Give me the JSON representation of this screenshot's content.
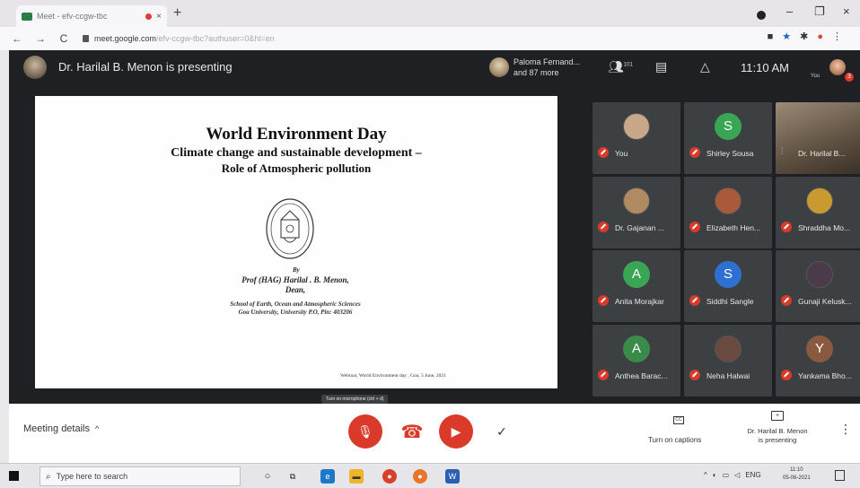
{
  "browser": {
    "tab_title": "Meet - efv-ccgw-tbc",
    "tab_close": "×",
    "new_tab": "+",
    "url_host": "meet.google.com",
    "url_path": "/efv-ccgw-tbc?authuser=0&hl=en",
    "nav_back": "←",
    "nav_forward": "→",
    "nav_reload": "C",
    "window_minimize": "–",
    "window_maximize": "❐",
    "window_close": "×"
  },
  "meet": {
    "presenting_banner": "Dr. Harilal B. Menon is presenting",
    "others_line1": "Paloma Fernand...",
    "others_line2": "and 87 more",
    "people_count": "101",
    "time": "11:10 AM",
    "self_label": "You",
    "notification_count": "3"
  },
  "slide": {
    "title": "World Environment Day",
    "subtitle_line1": "Climate change and sustainable development –",
    "subtitle_line2": "Role of  Atmospheric pollution",
    "by": "By",
    "author_line1": "Prof (HAG) Harilal . B. Menon,",
    "author_line2": "Dean,",
    "school_line1": "School of Earth, Ocean and Atmospheric Sciences",
    "school_line2": "Goa University, University P.O, Pin: 403206",
    "footer": "Webinar, World Environment day , Goa, 5 June, 2021"
  },
  "participants": [
    {
      "name": "You",
      "initial": "",
      "color": "#c9a889",
      "type": "photo"
    },
    {
      "name": "Shirley Sousa",
      "initial": "S",
      "color": "#3aa655",
      "type": "letter"
    },
    {
      "name": "Dr. Harilal B...",
      "initial": "",
      "color": "#7a6a58",
      "type": "video"
    },
    {
      "name": "Dr. Gajanan ...",
      "initial": "",
      "color": "#b08a60",
      "type": "photo"
    },
    {
      "name": "Elizabeth Hen...",
      "initial": "",
      "color": "#a85a3a",
      "type": "photo"
    },
    {
      "name": "Shraddha Mo...",
      "initial": "",
      "color": "#c99a30",
      "type": "photo"
    },
    {
      "name": "Anita Morajkar",
      "initial": "A",
      "color": "#3aa655",
      "type": "letter"
    },
    {
      "name": "Siddhi Sangle",
      "initial": "S",
      "color": "#2f6fd1",
      "type": "letter"
    },
    {
      "name": "Gunaji Kelusk...",
      "initial": "",
      "color": "#4a3a4a",
      "type": "photo"
    },
    {
      "name": "Anthea Barac...",
      "initial": "A",
      "color": "#3a8a4a",
      "type": "letter"
    },
    {
      "name": "Neha Halwai",
      "initial": "",
      "color": "#6a4a40",
      "type": "photo"
    },
    {
      "name": "Yankama Bho...",
      "initial": "Y",
      "color": "#8a5a40",
      "type": "letter"
    }
  ],
  "controls": {
    "meeting_details": "Meeting details",
    "details_caret": "^",
    "tooltip": "Turn on microphone (ctrl + d)",
    "captions_icon": "CC",
    "captions_label": "Turn on captions",
    "presenting_label_line1": "Dr. Harilal B. Menon",
    "presenting_label_line2": "is presenting",
    "more": "⋮"
  },
  "taskbar": {
    "search_placeholder": "Type here to search",
    "lang": "ENG",
    "clock_time": "11:10",
    "clock_date": "05-06-2021"
  }
}
